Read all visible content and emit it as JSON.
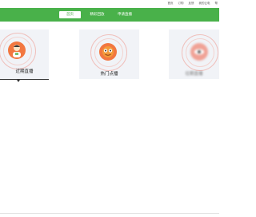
{
  "top_links": [
    "首页",
    "订购",
    "反馈",
    "我的云电",
    "帮"
  ],
  "nav": {
    "tabs": [
      "首页",
      "精彩回放",
      "申请直播"
    ],
    "active_index": 0
  },
  "cards": [
    {
      "label": "近期直播",
      "icon": "person-avatar-icon"
    },
    {
      "label": "热门点播",
      "icon": "smiley-face-icon"
    },
    {
      "label": "往期直播",
      "icon": "eye-icon"
    }
  ],
  "colors": {
    "nav_green": "#49b14a",
    "icon_orange": "#f27740",
    "card_bg": "#f1f3f7"
  }
}
